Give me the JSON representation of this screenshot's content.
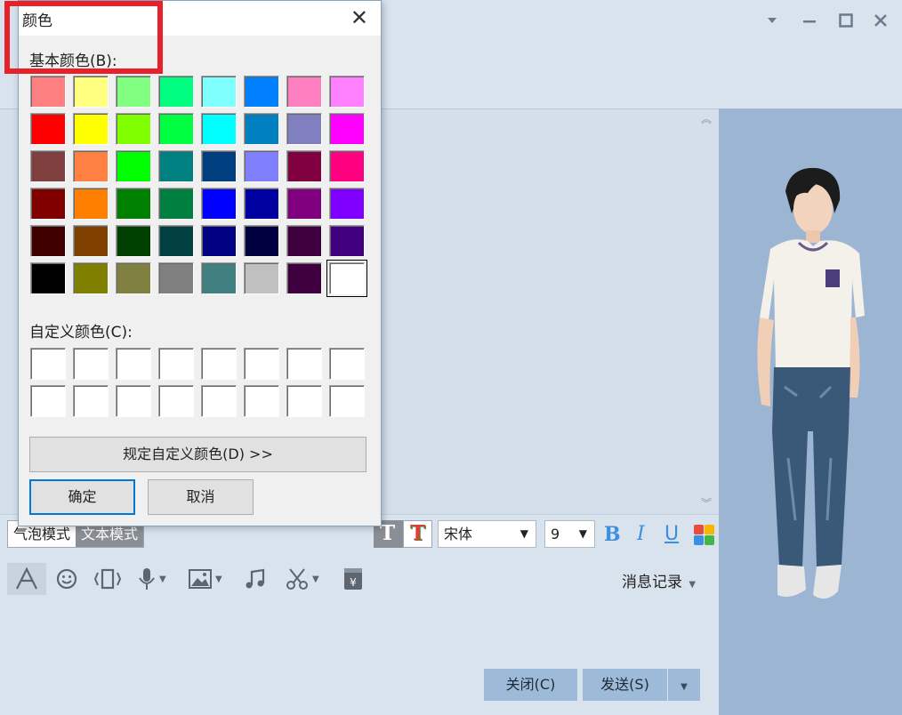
{
  "window": {
    "controls": [
      "dropdown-icon",
      "minimize-icon",
      "maximize-icon",
      "close-icon"
    ]
  },
  "dialog": {
    "title": "颜色",
    "basic_colors_label": "基本颜色(B):",
    "basic_colors": [
      "#ff8080",
      "#ffff80",
      "#80ff80",
      "#00ff80",
      "#80ffff",
      "#0080ff",
      "#ff80c0",
      "#ff80ff",
      "#ff0000",
      "#ffff00",
      "#80ff00",
      "#00ff40",
      "#00ffff",
      "#0080c0",
      "#8080c0",
      "#ff00ff",
      "#804040",
      "#ff8040",
      "#00ff00",
      "#008080",
      "#004080",
      "#8080ff",
      "#800040",
      "#ff0080",
      "#800000",
      "#ff8000",
      "#008000",
      "#008040",
      "#0000ff",
      "#0000a0",
      "#800080",
      "#8000ff",
      "#400000",
      "#804000",
      "#004000",
      "#004040",
      "#000080",
      "#000040",
      "#400040",
      "#400080",
      "#000000",
      "#808000",
      "#808040",
      "#808080",
      "#408080",
      "#c0c0c0",
      "#400040",
      "#ffffff"
    ],
    "selected_index": 47,
    "custom_colors_label": "自定义颜色(C):",
    "custom_colors": [
      "#ffffff",
      "#ffffff",
      "#ffffff",
      "#ffffff",
      "#ffffff",
      "#ffffff",
      "#ffffff",
      "#ffffff",
      "#ffffff",
      "#ffffff",
      "#ffffff",
      "#ffffff",
      "#ffffff",
      "#ffffff",
      "#ffffff",
      "#ffffff"
    ],
    "define_custom_label": "规定自定义颜色(D) >>",
    "ok_label": "确定",
    "cancel_label": "取消"
  },
  "toolbar": {
    "bubble_mode_label": "气泡模式",
    "text_mode_label": "文本模式",
    "font_name": "宋体",
    "font_size": "9",
    "bold_label": "B",
    "italic_label": "I",
    "underline_label": "U",
    "history_label": "消息记录"
  },
  "actions": {
    "close_label": "关闭(C)",
    "send_label": "发送(S)"
  },
  "colors": {
    "highlight": "#e8202a",
    "format_icons": "#3b8fe0",
    "button_bg": "#9dbad8"
  }
}
